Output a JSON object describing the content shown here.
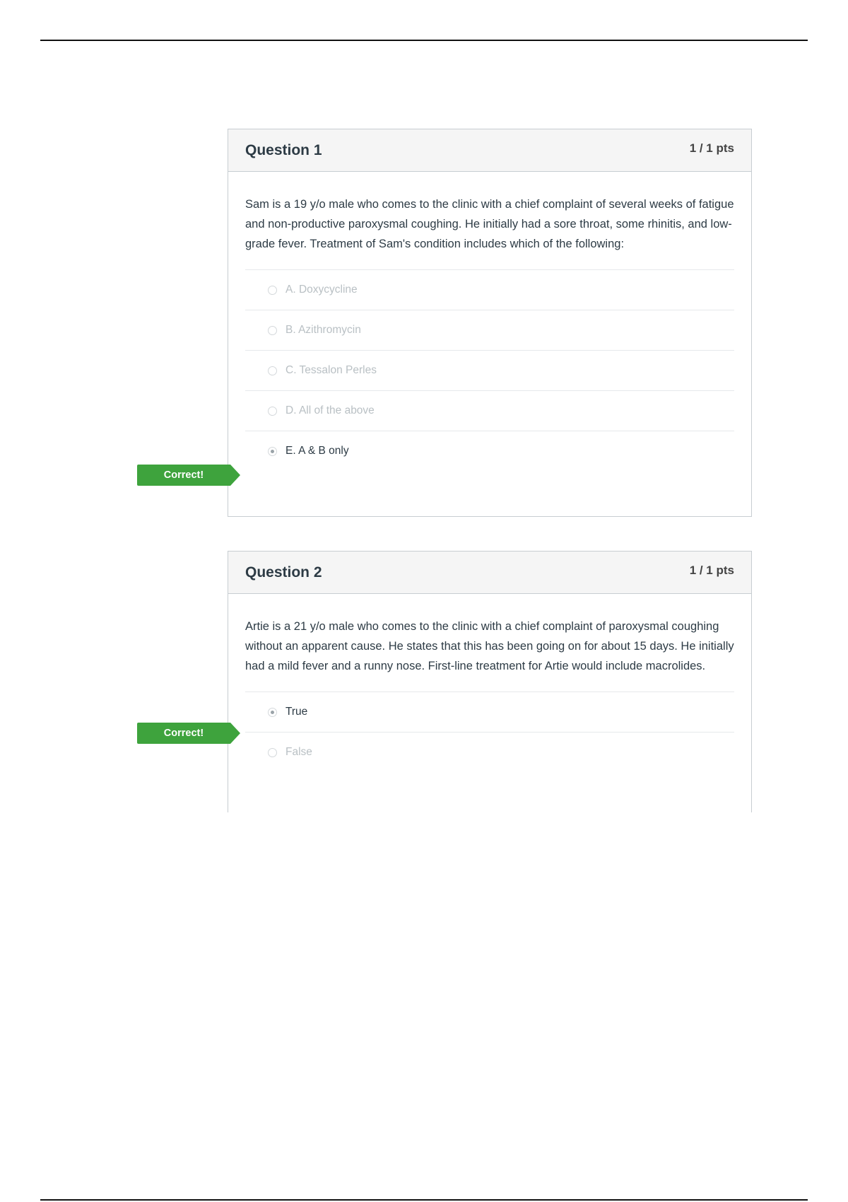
{
  "questions": [
    {
      "title": "Question 1",
      "points": "1 / 1 pts",
      "text": "Sam is a 19 y/o male who comes to the clinic with a chief complaint of several weeks of fatigue and non-productive paroxysmal coughing. He initially had a sore throat, some rhinitis, and low-grade fever. Treatment of Sam's condition includes which of the following:",
      "answers": [
        {
          "label": "A. Doxycycline",
          "selected": false
        },
        {
          "label": "B. Azithromycin",
          "selected": false
        },
        {
          "label": "C. Tessalon Perles",
          "selected": false
        },
        {
          "label": "D. All of the above",
          "selected": false
        },
        {
          "label": "E. A & B only",
          "selected": true
        }
      ],
      "feedback": "Correct!"
    },
    {
      "title": "Question 2",
      "points": "1 / 1 pts",
      "text": "Artie is a 21 y/o male who comes to the clinic with a chief complaint of paroxysmal coughing without an apparent cause. He states that this has been going on for about 15 days. He initially had a mild fever and a runny nose. First-line treatment for Artie would include macrolides.",
      "answers": [
        {
          "label": "True",
          "selected": true
        },
        {
          "label": "False",
          "selected": false
        }
      ],
      "feedback": "Correct!"
    }
  ],
  "colors": {
    "correct_badge": "#3ea33d",
    "header_bg": "#f5f5f5",
    "border": "#c7cdd1"
  }
}
